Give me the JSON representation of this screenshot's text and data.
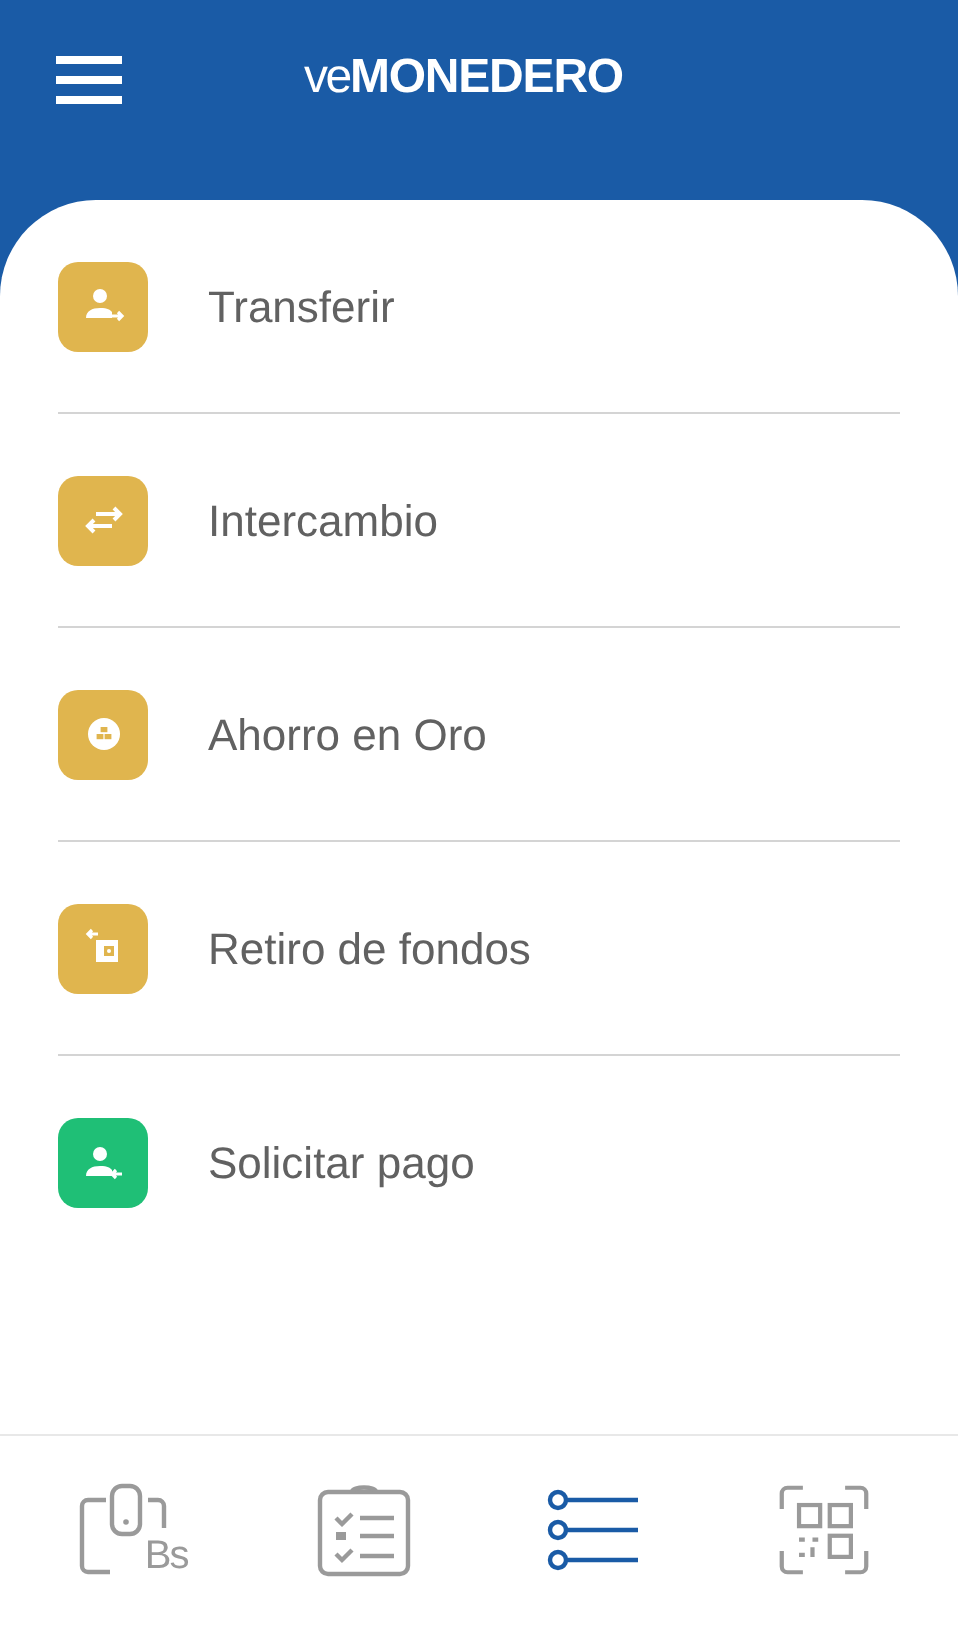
{
  "header": {
    "logo_prefix": "ve",
    "logo_name": "MONEDERO"
  },
  "menu": [
    {
      "label": "Transferir",
      "kind": "send",
      "color": "#e0b54e"
    },
    {
      "label": "Intercambio",
      "kind": "exchange",
      "color": "#e0b54e"
    },
    {
      "label": "Ahorro en Oro",
      "kind": "gold",
      "color": "#e0b54e"
    },
    {
      "label": "Retiro de fondos",
      "kind": "withdraw",
      "color": "#e0b54e"
    },
    {
      "label": "Solicitar pago",
      "kind": "request",
      "color": "#1fbf76"
    }
  ],
  "bottom_nav": [
    {
      "kind": "wallet",
      "text": "Bs",
      "selected": false
    },
    {
      "kind": "checklist",
      "selected": false
    },
    {
      "kind": "list",
      "selected": true
    },
    {
      "kind": "qr",
      "selected": false
    }
  ]
}
